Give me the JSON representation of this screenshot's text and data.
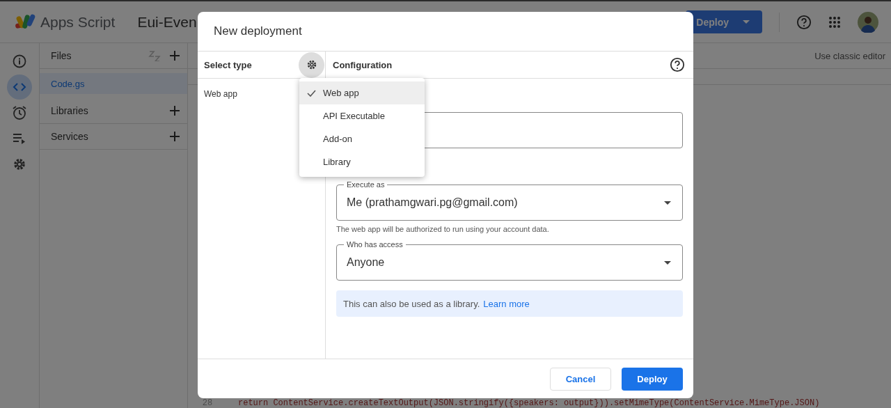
{
  "app": {
    "name": "Apps Script",
    "project_title": "Eui-Even",
    "deploy_button": "Deploy",
    "classic_editor_link": "Use classic editor"
  },
  "rail": [
    {
      "selected": false
    },
    {
      "selected": true
    },
    {
      "selected": false
    },
    {
      "selected": false
    },
    {
      "selected": false
    }
  ],
  "files_panel": {
    "sections": [
      {
        "title": "Files",
        "sort": true,
        "items": [
          {
            "label": "Code.gs",
            "selected": true
          }
        ]
      },
      {
        "title": "Libraries",
        "sort": false
      },
      {
        "title": "Services",
        "sort": false
      }
    ]
  },
  "editor": {
    "code_line": {
      "number": "28",
      "text": "return ContentService.createTextOutput(JSON.stringify({speakers: output})).setMimeType(ContentService.MimeType.JSON)"
    }
  },
  "dialog": {
    "title": "New deployment",
    "select_type_label": "Select type",
    "configuration_label": "Configuration",
    "selected_types": [
      "Web app"
    ],
    "type_menu": [
      {
        "label": "Web app",
        "selected": true
      },
      {
        "label": "API Executable",
        "selected": false
      },
      {
        "label": "Add-on",
        "selected": false
      },
      {
        "label": "Library",
        "selected": false
      }
    ],
    "fields": [
      {
        "kind": "text"
      },
      {
        "kind": "select",
        "label": "Execute as",
        "value": "Me (prathamgwari.pg@gmail.com)",
        "hint": "The web app will be authorized to run using your account data."
      },
      {
        "kind": "select",
        "label": "Who has access",
        "value": "Anyone"
      }
    ],
    "info": {
      "text": "This can also be used as a library.",
      "link": "Learn more"
    },
    "buttons": [
      {
        "label": "Cancel",
        "kind": "secondary"
      },
      {
        "label": "Deploy",
        "kind": "primary"
      }
    ]
  }
}
